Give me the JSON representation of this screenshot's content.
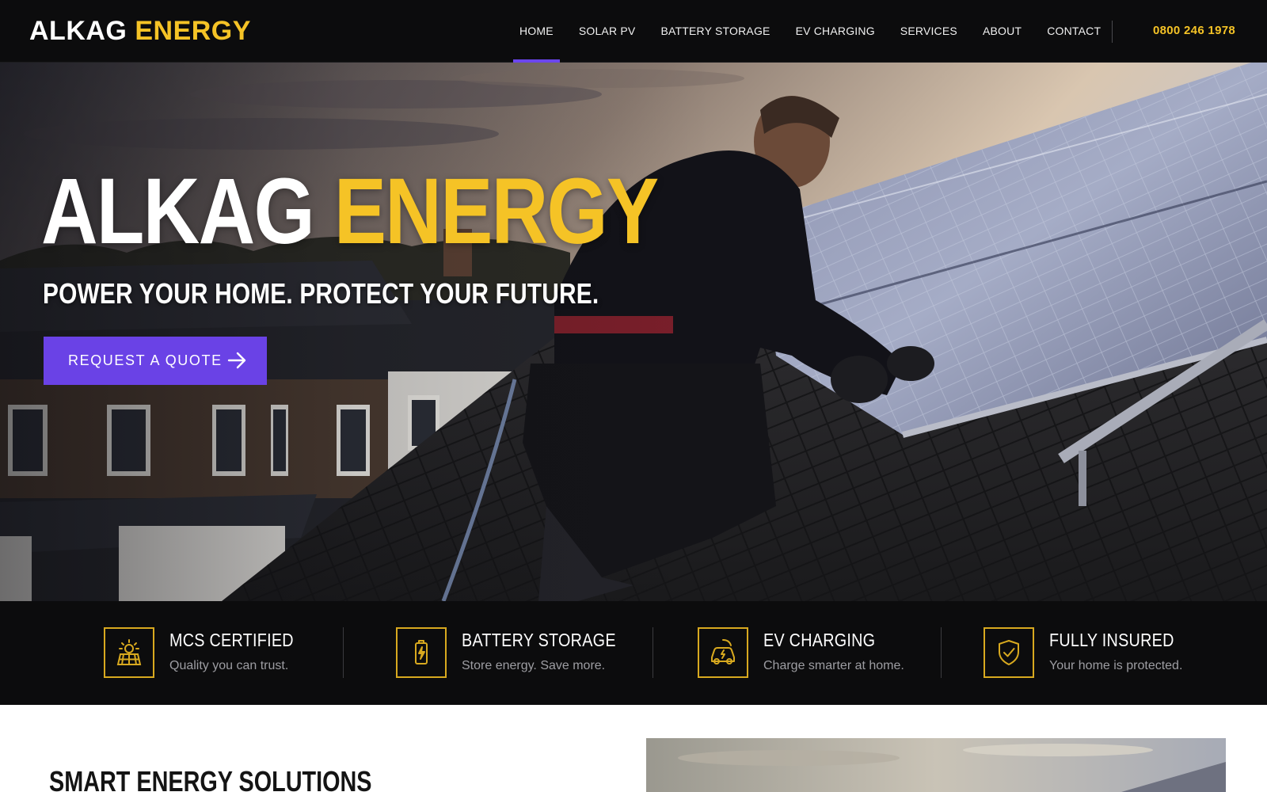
{
  "header": {
    "logo_main": "ALKAG",
    "logo_accent": "ENERGY",
    "nav": [
      {
        "label": "HOME",
        "active": true
      },
      {
        "label": "SOLAR PV",
        "active": false
      },
      {
        "label": "BATTERY STORAGE",
        "active": false
      },
      {
        "label": "EV CHARGING",
        "active": false
      },
      {
        "label": "SERVICES",
        "active": false
      },
      {
        "label": "ABOUT",
        "active": false
      },
      {
        "label": "CONTACT",
        "active": false
      }
    ],
    "phone": "0800 246 1978"
  },
  "hero": {
    "title_main": "ALKAG",
    "title_accent": "ENERGY",
    "tagline": "POWER YOUR HOME. PROTECT YOUR FUTURE.",
    "cta_label": "REQUEST A QUOTE",
    "cta_icon": "arrow-right-icon"
  },
  "features": [
    {
      "icon": "solar-panel-icon",
      "title": "MCS CERTIFIED",
      "subtitle": "Quality you can trust."
    },
    {
      "icon": "battery-icon",
      "title": "BATTERY STORAGE",
      "subtitle": "Store energy. Save more."
    },
    {
      "icon": "ev-car-icon",
      "title": "EV CHARGING",
      "subtitle": "Charge smarter at home."
    },
    {
      "icon": "shield-check-icon",
      "title": "FULLY INSURED",
      "subtitle": "Your home is protected."
    }
  ],
  "section2": {
    "title": "SMART ENERGY SOLUTIONS"
  },
  "colors": {
    "accent_yellow": "#f5c326",
    "accent_purple": "#6a42e6",
    "header_bg": "#0c0c0d",
    "feature_bar_bg": "#0c0c0d"
  }
}
